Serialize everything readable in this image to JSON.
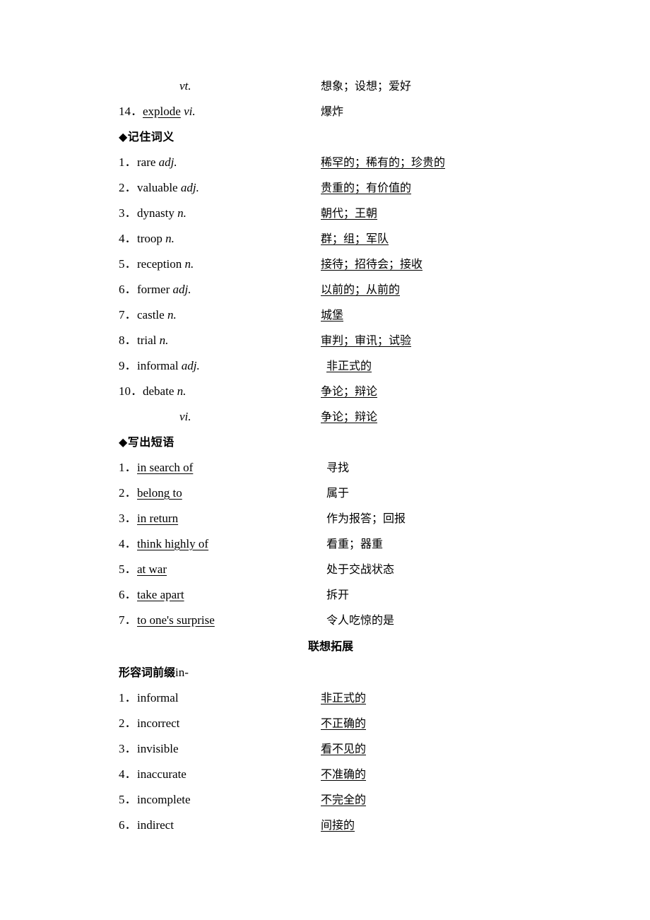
{
  "page": {
    "top_rows": [
      {
        "num": "",
        "en_prefix": "",
        "en": "vt.",
        "en_italic": true,
        "en_underline": false,
        "cn": "想象；设想；爱好",
        "cn_underline": false,
        "indent": true
      },
      {
        "num": "14．",
        "en_prefix": "explode",
        "en": "vi.",
        "en_italic": true,
        "en_underline": true,
        "cn": "爆炸",
        "cn_underline": false,
        "indent": false
      }
    ],
    "sections": [
      {
        "heading": "◆记住词义",
        "rows": [
          {
            "num": "1．",
            "en_word": "rare",
            "en_pos": "adj.",
            "cn": "稀罕的；稀有的；珍贵的",
            "cn_underline": true
          },
          {
            "num": "2．",
            "en_word": "valuable",
            "en_pos": "adj.",
            "cn": "贵重的；有价值的",
            "cn_underline": true
          },
          {
            "num": "3．",
            "en_word": "dynasty",
            "en_pos": "n.",
            "cn": "朝代；王朝",
            "cn_underline": true
          },
          {
            "num": "4．",
            "en_word": "troop",
            "en_pos": "n.",
            "cn": "群；组；军队",
            "cn_underline": true
          },
          {
            "num": "5．",
            "en_word": "reception",
            "en_pos": "n.",
            "cn": "接待；招待会；接收",
            "cn_underline": true
          },
          {
            "num": "6．",
            "en_word": "former",
            "en_pos": "adj.",
            "cn": "以前的；从前的",
            "cn_underline": true
          },
          {
            "num": "7．",
            "en_word": "castle",
            "en_pos": "n.",
            "cn": "城堡",
            "cn_underline": true
          },
          {
            "num": "8．",
            "en_word": "trial",
            "en_pos": "n.",
            "cn": "审判；审讯；试验",
            "cn_underline": true
          },
          {
            "num": "9．",
            "en_word": "informal",
            "en_pos": "adj.",
            "cn": "非正式的",
            "cn_underline": true,
            "cn_indent": true
          },
          {
            "num": "10．",
            "en_word": "debate",
            "en_pos": "n.",
            "cn": "争论；辩论",
            "cn_underline": true
          },
          {
            "num": "",
            "en_word": "",
            "en_pos": "vi.",
            "cn": "争论；辩论",
            "cn_underline": true,
            "indent": true
          }
        ]
      },
      {
        "heading": "◆写出短语",
        "rows": [
          {
            "num": "1．",
            "en_phrase": "in search of",
            "cn": "寻找"
          },
          {
            "num": "2．",
            "en_phrase": "belong to",
            "cn": "属于"
          },
          {
            "num": "3．",
            "en_phrase": "in return",
            "cn": "作为报答；回报"
          },
          {
            "num": "4．",
            "en_phrase": "think highly of",
            "cn": "看重；器重"
          },
          {
            "num": "5．",
            "en_phrase": "at war",
            "cn": "处于交战状态"
          },
          {
            "num": "6．",
            "en_phrase": "take apart",
            "cn": "拆开"
          },
          {
            "num": "7．",
            "en_phrase": "to one's surprise",
            "cn": "令人吃惊的是"
          }
        ]
      }
    ],
    "center_heading": "联想拓展",
    "prefix_section": {
      "heading_cn": "形容词前缀",
      "heading_en": "in-",
      "rows": [
        {
          "num": "1．",
          "en": "informal",
          "cn": "非正式的"
        },
        {
          "num": "2．",
          "en": "incorrect",
          "cn": "不正确的"
        },
        {
          "num": "3．",
          "en": "invisible",
          "cn": "看不见的"
        },
        {
          "num": "4．",
          "en": "inaccurate",
          "cn": "不准确的"
        },
        {
          "num": "5．",
          "en": "incomplete",
          "cn": "不完全的"
        },
        {
          "num": "6．",
          "en": "indirect",
          "cn": "间接的"
        }
      ]
    }
  }
}
